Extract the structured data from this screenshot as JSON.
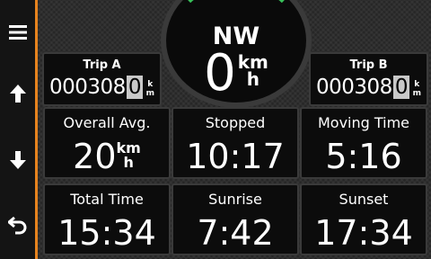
{
  "sidebar": {
    "menu_icon": "hamburger-menu-icon",
    "up_icon": "arrow-up-icon",
    "down_icon": "arrow-down-icon",
    "back_icon": "back-arrow-icon",
    "accent_color": "#e6831e"
  },
  "compass": {
    "heading": "NW",
    "speed": "0",
    "speed_unit_top": "km",
    "speed_unit_bottom": "h",
    "ring_color": "#38c25a"
  },
  "trip_a": {
    "label": "Trip A",
    "value": "000308",
    "decimal": "0",
    "unit_top": "k",
    "unit_bottom": "m"
  },
  "trip_b": {
    "label": "Trip B",
    "value": "000308",
    "decimal": "0",
    "unit_top": "k",
    "unit_bottom": "m"
  },
  "tiles": [
    {
      "label": "Overall Avg.",
      "value": "20",
      "unit_top": "km",
      "unit_bottom": "h"
    },
    {
      "label": "Stopped",
      "value": "10:17"
    },
    {
      "label": "Moving Time",
      "value": "5:16"
    },
    {
      "label": "Total Time",
      "value": "15:34"
    },
    {
      "label": "Sunrise",
      "value": "7:42"
    },
    {
      "label": "Sunset",
      "value": "17:34"
    }
  ]
}
